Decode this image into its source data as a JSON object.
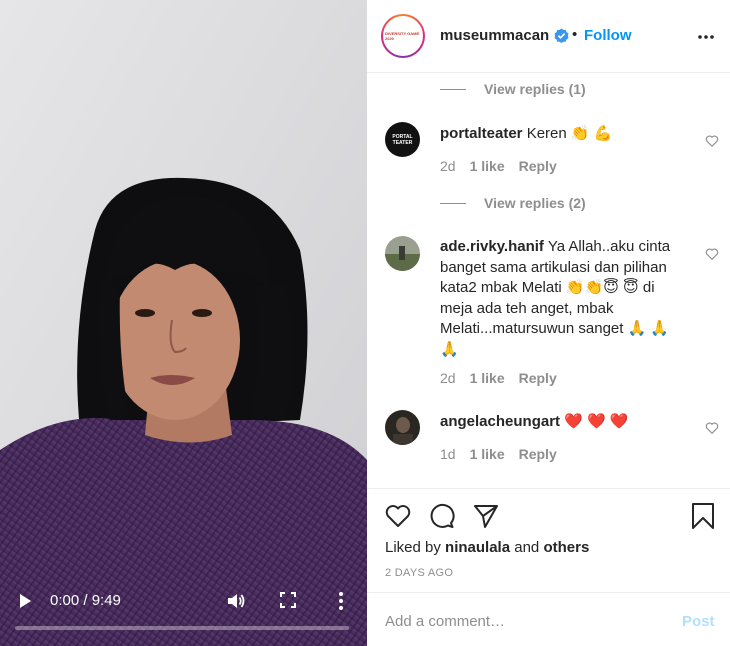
{
  "video": {
    "time": "0:00 / 9:49",
    "progress": 0.0
  },
  "header": {
    "avatar_text": "DIVERSITY GAME 2020",
    "username": "museummacan",
    "dot": "•",
    "follow": "Follow"
  },
  "comments": {
    "view_replies_1": "View replies (1)",
    "view_replies_2": "View replies (2)",
    "items": [
      {
        "username": "portalteater",
        "avatar_text": "PORTAL TEATER",
        "text": "Keren 👏 💪",
        "time": "2d",
        "likes": "1 like",
        "reply": "Reply"
      },
      {
        "username": "ade.rivky.hanif",
        "text": "Ya Allah..aku cinta banget sama artikulasi dan pilihan kata2 mbak Melati 👏👏😇 😇  di meja ada teh anget, mbak Melati...matursuwun sanget 🙏 🙏 🙏",
        "time": "2d",
        "likes": "1 like",
        "reply": "Reply"
      },
      {
        "username": "angelacheungart",
        "text": "❤️ ❤️ ❤️",
        "time": "1d",
        "likes": "1 like",
        "reply": "Reply"
      }
    ]
  },
  "actions": {
    "liked_by_prefix": "Liked by",
    "liked_by_user": "ninaulala",
    "and": "and",
    "others": "others",
    "date": "2 DAYS AGO"
  },
  "add_comment": {
    "placeholder": "Add a comment…",
    "post": "Post"
  },
  "colors": {
    "accent": "#0095f6",
    "muted": "#8e8e8e",
    "post_disabled": "#b2dffc"
  }
}
